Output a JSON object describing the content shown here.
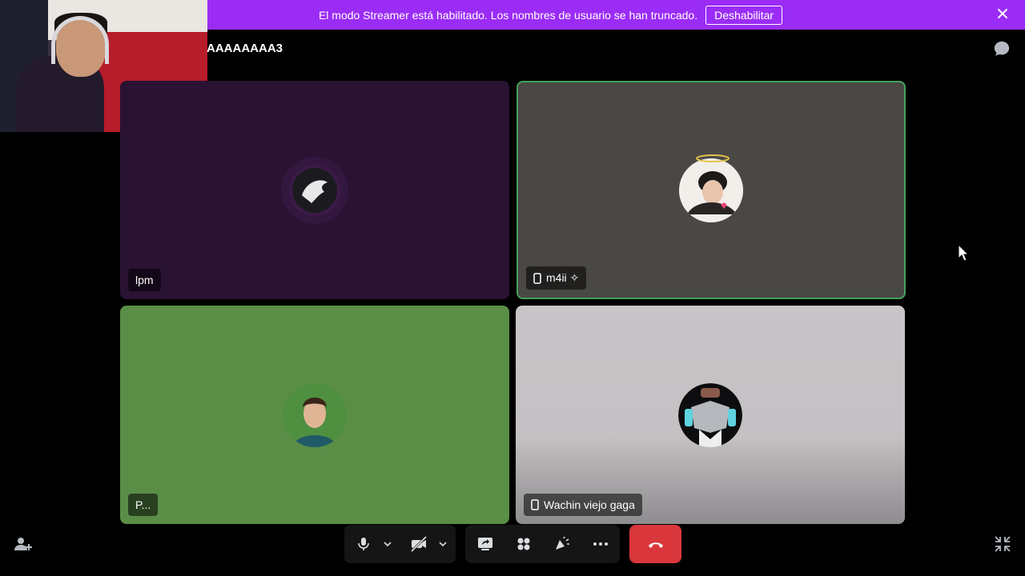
{
  "banner": {
    "message": "El modo Streamer está habilitado. Los nombres de usuario se han truncado.",
    "disable_label": "Deshabilitar"
  },
  "channel": {
    "title": "AAAAAAAA3"
  },
  "tiles": [
    {
      "name": "lpm",
      "device": "",
      "speaking": false
    },
    {
      "name": "m4ii ✧",
      "device": "phone",
      "speaking": true
    },
    {
      "name": "P...",
      "device": "",
      "speaking": false
    },
    {
      "name": "Wachin viejo gaga",
      "device": "phone",
      "speaking": false
    }
  ],
  "colors": {
    "banner": "#9b2cf5",
    "speaking_border": "#43a25a",
    "hangup": "#da373c"
  },
  "icons": {
    "banner_close": "close-icon",
    "chat": "chat-icon",
    "mic": "microphone-icon",
    "camera": "camera-off-icon",
    "screenshare": "screen-share-icon",
    "activities": "activities-icon",
    "soundboard": "soundboard-icon",
    "more": "more-icon",
    "hangup": "phone-hangup-icon",
    "invite": "add-user-icon",
    "exit_fullscreen": "exit-fullscreen-icon"
  }
}
